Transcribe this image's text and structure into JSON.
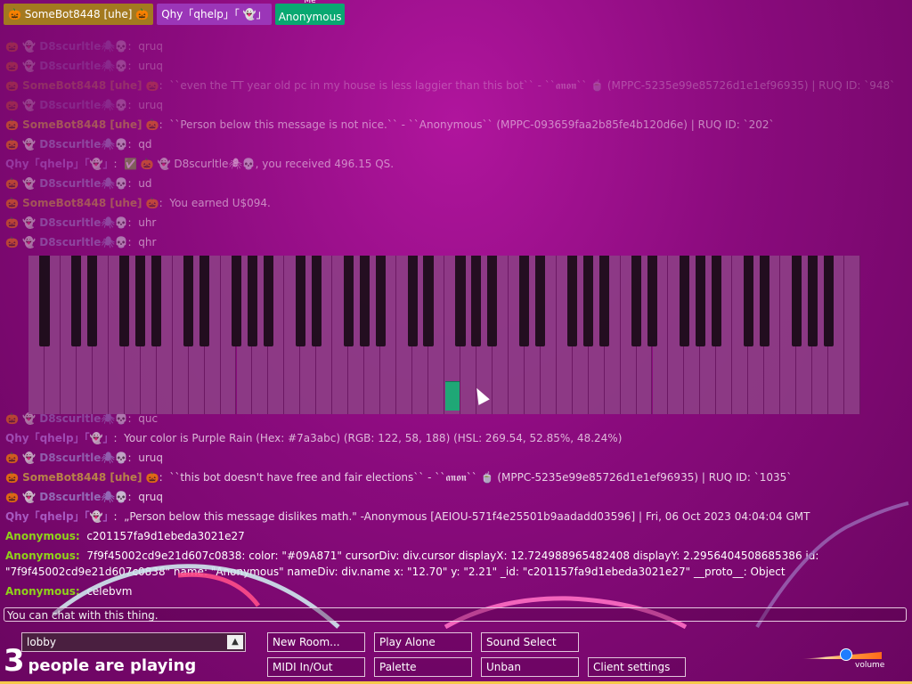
{
  "users": [
    {
      "prefix": "🎃",
      "name": "SomeBot8448 [uhe]",
      "suffix": "🎃",
      "color": "#a3791f"
    },
    {
      "prefix": "",
      "name": "Qhy「qhelp」「",
      "suffix": "👻」",
      "color": "#9b36b8"
    },
    {
      "me_label": "Me",
      "name": "Anonymous",
      "color": "#09a871"
    }
  ],
  "chat": [
    {
      "name": "🎃 👻 D8scurltle🕷💀",
      "msg": "qruq"
    },
    {
      "name": "🎃 👻 D8scurltle🕷💀",
      "msg": "uruq"
    },
    {
      "name": "🎃 SomeBot8448 [uhe] 🎃",
      "msg": "``even the TT year old pc in my house is less laggier than this bot`` - ``𝖆𝖓𝖔𝖓`` 🍵 (MPPC-5235e99e85726d1e1ef96935) | RUQ ID: `948`"
    },
    {
      "name": "🎃 👻 D8scurltle🕷💀",
      "msg": "uruq"
    },
    {
      "name": "🎃 SomeBot8448 [uhe] 🎃",
      "msg": "``Person below this message is not nice.`` - ``Anonymous`` (MPPC-093659faa2b85fe4b120d6e) | RUQ ID: `202`"
    },
    {
      "name": "🎃 👻 D8scurltle🕷💀",
      "msg": "qd"
    },
    {
      "name": "Qhy「qhelp」「👻」",
      "msg": "✅ 🎃 👻 D8scurltle🕷💀, you received 496.15 QS."
    },
    {
      "name": "🎃 👻 D8scurltle🕷💀",
      "msg": "ud"
    },
    {
      "name": "🎃 SomeBot8448 [uhe] 🎃",
      "msg": "You earned U$094."
    },
    {
      "name": "🎃 👻 D8scurltle🕷💀",
      "msg": "uhr"
    },
    {
      "name": "🎃 👻 D8scurltle🕷💀",
      "msg": "qhr"
    }
  ],
  "chat_lower": [
    {
      "name": "🎃 👻 D8scurltle🕷💀",
      "msg": "quc"
    },
    {
      "name": "Qhy「qhelp」「👻」",
      "msg": "Your color is Purple Rain (Hex: #7a3abc) (RGB: 122, 58, 188) (HSL: 269.54, 52.85%, 48.24%)"
    },
    {
      "name": "🎃 👻 D8scurltle🕷💀",
      "msg": "uruq"
    },
    {
      "name": "🎃 SomeBot8448 [uhe] 🎃",
      "msg": "``this bot doesn't have free and fair elections`` - ``𝖆𝖓𝖔𝖓`` 🍵 (MPPC-5235e99e85726d1e1ef96935) | RUQ ID: `1035`"
    },
    {
      "name": "🎃 👻 D8scurltle🕷💀",
      "msg": "qruq"
    },
    {
      "name": "Qhy「qhelp」「👻」",
      "msg": "„Person below this message dislikes math.\" -Anonymous [AEIOU-571f4e25501b9aadadd03596] | Fri, 06 Oct 2023 04:04:04 GMT"
    },
    {
      "name": "Anonymous:",
      "msg": "c201157fa9d1ebeda3021e27"
    },
    {
      "name": "Anonymous:",
      "msg": "7f9f45002cd9e21d607c0838: color: \"#09A871\" cursorDiv: div.cursor displayX: 12.724988965482408 displayY: 2.2956404508685386 id:"
    },
    {
      "name": "",
      "msg": "\"7f9f45002cd9e21d607c0838\" name: \"Anonymous\" nameDiv: div.name x: \"12.70\" y: \"2.21\" _id: \"c201157fa9d1ebeda3021e27\" __proto__: Object"
    },
    {
      "name": "Anonymous:",
      "msg": "celebvm"
    }
  ],
  "chat_input_placeholder": "You can chat with this thing.",
  "room": {
    "name": "lobby"
  },
  "players": {
    "count": "3",
    "label": "people are playing"
  },
  "buttons": {
    "new_room": "New Room...",
    "play_alone": "Play Alone",
    "sound_select": "Sound Select",
    "midi": "MIDI In/Out",
    "palette": "Palette",
    "unban": "Unban",
    "client_settings": "Client settings"
  },
  "volume": {
    "label": "volume",
    "level": 0.55
  },
  "colors": {
    "anonymous": "#8fd11a",
    "bot": "#a3791f",
    "qhy": "#9b36b8",
    "scurl": "#9b82c8",
    "accent": "#09a871"
  }
}
